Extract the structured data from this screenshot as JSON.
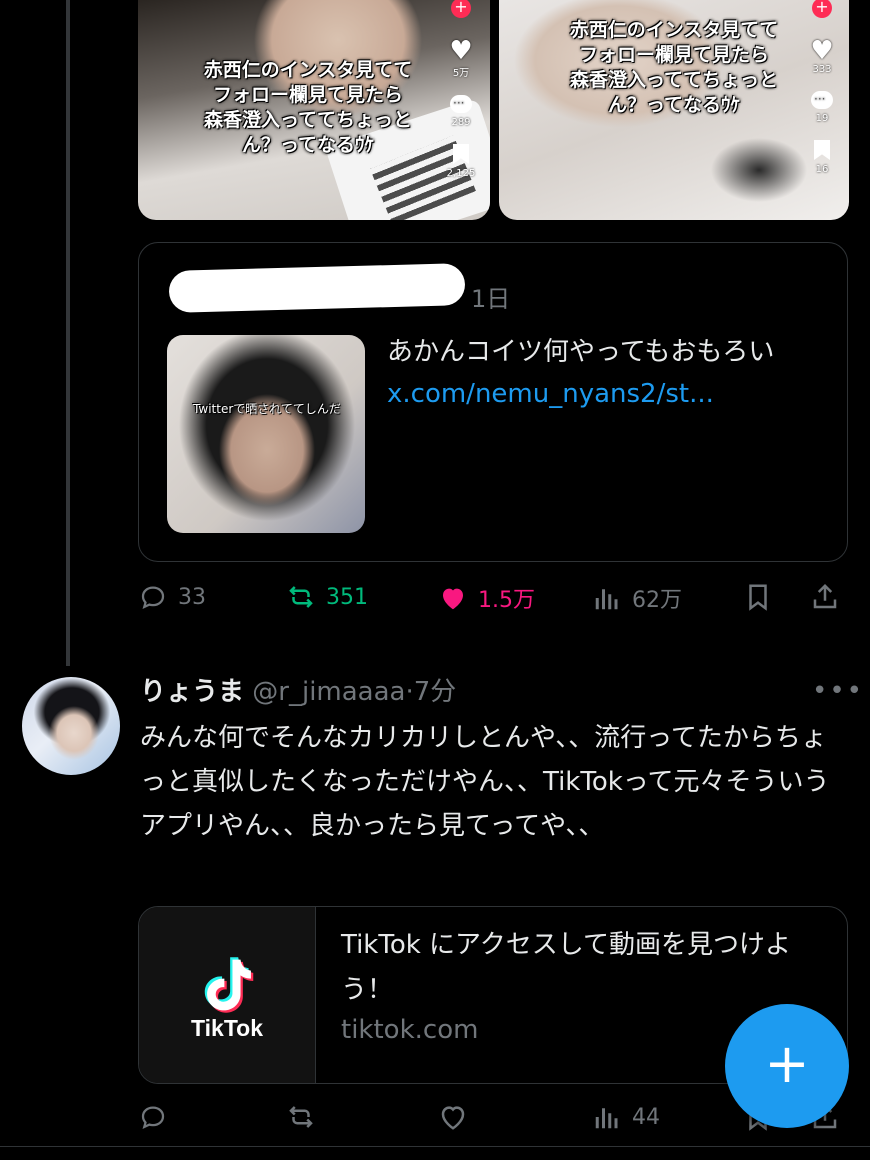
{
  "videos": [
    {
      "caption_lines": [
        "赤西仁のインスタ見てて",
        "フォロー欄見て見たら",
        "森香澄入っててちょっと",
        "ん？ってなるｳｹ"
      ],
      "likes": "5万",
      "comments": "289",
      "saves": "2,125"
    },
    {
      "caption_lines": [
        "赤西仁のインスタ見てて",
        "フォロー欄見て見たら",
        "森香澄入っててちょっと",
        "ん？ってなるｳｹ"
      ],
      "likes": "333",
      "comments": "19",
      "saves": "16"
    }
  ],
  "quoted_tweet": {
    "time": "1日",
    "text": "あかんコイツ何やってもおもろい ",
    "link": "x.com/nemu_nyans2/st...",
    "media_caption": "Twitterで晒されててしんだ"
  },
  "main_actions": {
    "replies": "33",
    "retweets": "351",
    "likes": "1.5万",
    "views": "62万"
  },
  "reply": {
    "name": "りょうま",
    "handle": "@r_jimaaaa",
    "time": "7分",
    "text": "みんな何でそんなカリカリしとんや、、流行ってたからちょっと真似したくなっただけやん、、TikTokって元々そういうアプリやん、、良かったら見てってや、、",
    "link_card": {
      "brand": "TikTok",
      "title": "TikTok にアクセスして動画を見つけよう！",
      "domain": "tiktok.com"
    },
    "actions": {
      "views": "44"
    }
  },
  "fab": {
    "label": "+"
  },
  "colors": {
    "accent": "#1d9bf0",
    "like": "#f91880",
    "retweet": "#00ba7c",
    "muted": "#71767b",
    "background": "#000000"
  }
}
